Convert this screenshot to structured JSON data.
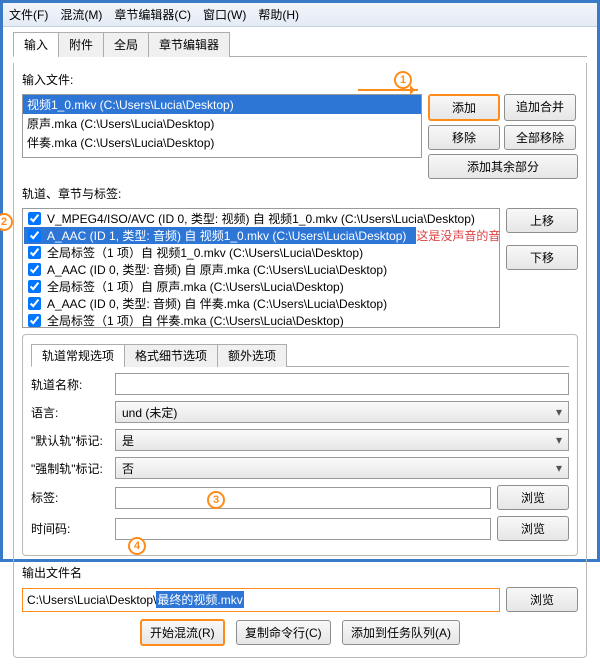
{
  "menubar": {
    "file": "文件(F)",
    "mux": "混流(M)",
    "chapters": "章节编辑器(C)",
    "window": "窗口(W)",
    "help": "帮助(H)"
  },
  "tabs": {
    "input": "输入",
    "attachments": "附件",
    "global": "全局",
    "chapters": "章节编辑器"
  },
  "input": {
    "label": "输入文件:",
    "items": {
      "0": "视频1_0.mkv (C:\\Users\\Lucia\\Desktop)",
      "1": "原声.mka (C:\\Users\\Lucia\\Desktop)",
      "2": "伴奏.mka (C:\\Users\\Lucia\\Desktop)"
    }
  },
  "buttons": {
    "add": "添加",
    "append": "追加合并",
    "remove": "移除",
    "remove_all": "全部移除",
    "add_rest": "添加其余部分",
    "up": "上移",
    "down": "下移",
    "browse": "浏览",
    "start": "开始混流(R)",
    "copycmd": "复制命令行(C)",
    "addjob": "添加到任务队列(A)"
  },
  "tracks": {
    "label": "轨道、章节与标签:",
    "items": {
      "0": "V_MPEG4/ISO/AVC (ID 0, 类型: 视频) 自 视频1_0.mkv (C:\\Users\\Lucia\\Desktop)",
      "1": "A_AAC (ID 1, 类型: 音频) 自 视频1_0.mkv (C:\\Users\\Lucia\\Desktop)",
      "2": "全局标签（1 项）自 视频1_0.mkv (C:\\Users\\Lucia\\Desktop)",
      "3": "A_AAC (ID 0, 类型: 音频) 自 原声.mka (C:\\Users\\Lucia\\Desktop)",
      "4": "全局标签（1 项）自 原声.mka (C:\\Users\\Lucia\\Desktop)",
      "5": "A_AAC (ID 0, 类型: 音频) 自 伴奏.mka (C:\\Users\\Lucia\\Desktop)",
      "6": "全局标签（1 项）自 伴奏.mka (C:\\Users\\Lucia\\Desktop)"
    },
    "annotation": "这是没声音的音频，可去掉勾选"
  },
  "subtabs": {
    "general": "轨道常规选项",
    "format": "格式细节选项",
    "extra": "额外选项"
  },
  "form": {
    "trackname_label": "轨道名称:",
    "language_label": "语言:",
    "language_value": "und (未定)",
    "default_label": "\"默认轨\"标记:",
    "default_value": "是",
    "forced_label": "\"强制轨\"标记:",
    "forced_value": "否",
    "tags_label": "标签:",
    "timecodes_label": "时间码:"
  },
  "output": {
    "label": "输出文件名",
    "prefix": "C:\\Users\\Lucia\\Desktop\\",
    "selected": "最终的视频.mkv"
  },
  "circ": {
    "c1": "1",
    "c2": "2",
    "c3": "3",
    "c4": "4"
  }
}
